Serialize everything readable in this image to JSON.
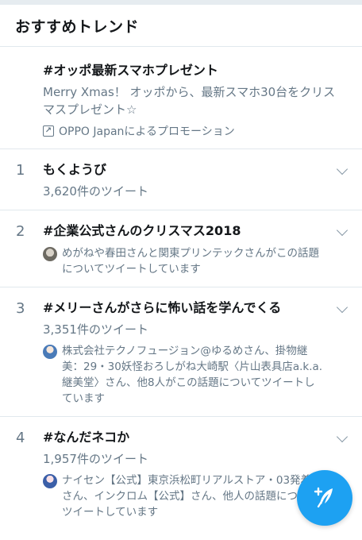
{
  "header": {
    "title": "おすすめトレンド"
  },
  "promoted": {
    "name": "#オッポ最新スマホプレゼント",
    "description": "Merry Xmas！ オッポから、最新スマホ30台をクリスマスプレゼント☆",
    "promotion_icon": "promoted-arrow-icon",
    "promotion_text": "OPPO Japanによるプロモーション"
  },
  "trends": [
    {
      "rank": "1",
      "name": "もくようび",
      "count": "3,620件のツイート",
      "context": ""
    },
    {
      "rank": "2",
      "name": "#企業公式さんのクリスマス2018",
      "count": "",
      "context": "めがねや春田さんと関東プリンテックさんがこの話題についてツイートしています"
    },
    {
      "rank": "3",
      "name": "#メリーさんがさらに怖い話を学んでくる",
      "count": "3,351件のツイート",
      "context": "株式会社テクノフュージョン@ゆるめさん、掛物継美：29・30妖怪おろしがね大崎駅〈片山表具店a.k.a. 継美堂〉さん、他8人がこの話題についてツイートしています"
    },
    {
      "rank": "4",
      "name": "#なんだネコか",
      "count": "1,957件のツイート",
      "context": "ナイセン【公式】東京浜松町リアルストア・03発着信さん、インクロム【公式】さん、他人の話題についてツイートしています"
    }
  ],
  "compose": {
    "icon": "compose-tweet-icon"
  },
  "colors": {
    "accent": "#1da1f2",
    "secondary_text": "#657786",
    "divider": "#e1e8ed"
  }
}
